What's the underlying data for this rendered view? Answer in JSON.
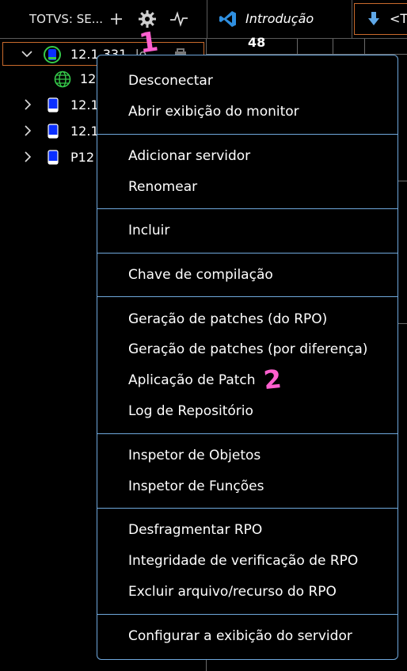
{
  "sidebar": {
    "title": "TOTVS: SE...",
    "icons": [
      "plus-icon",
      "gear-icon",
      "pulse-icon"
    ]
  },
  "tabs": [
    {
      "label": "Introdução",
      "icon": "vscode-icon"
    },
    {
      "label": "<T",
      "icon": "arrow-down-icon"
    }
  ],
  "tree": {
    "items": [
      {
        "label": "12.1.331",
        "suffix": "lo",
        "expanded": true,
        "selected": true
      },
      {
        "label": "12",
        "child": true
      },
      {
        "label": "12.1"
      },
      {
        "label": "12.1"
      },
      {
        "label": "P12"
      }
    ]
  },
  "editor": {
    "value": "48"
  },
  "menu": {
    "groups": [
      [
        "Desconectar",
        "Abrir exibição do monitor"
      ],
      [
        "Adicionar servidor",
        "Renomear"
      ],
      [
        "Incluir"
      ],
      [
        "Chave de compilação"
      ],
      [
        "Geração de patches (do RPO)",
        "Geração de patches (por diferença)",
        "Aplicação de Patch",
        "Log de Repositório"
      ],
      [
        "Inspetor de Objetos",
        "Inspetor de Funções"
      ],
      [
        "Desfragmentar RPO",
        "Integridade de verificação de RPO",
        "Excluir arquivo/recurso do RPO"
      ],
      [
        "Configurar a exibição do servidor"
      ]
    ]
  },
  "annotations": {
    "one": "1",
    "two": "2",
    "color": "#ff5fcf"
  },
  "colors": {
    "menu_border": "#6fa8dc",
    "selection_border": "#c96a2c",
    "server_blue": "#1f3bff",
    "server_green": "#35c94a"
  }
}
